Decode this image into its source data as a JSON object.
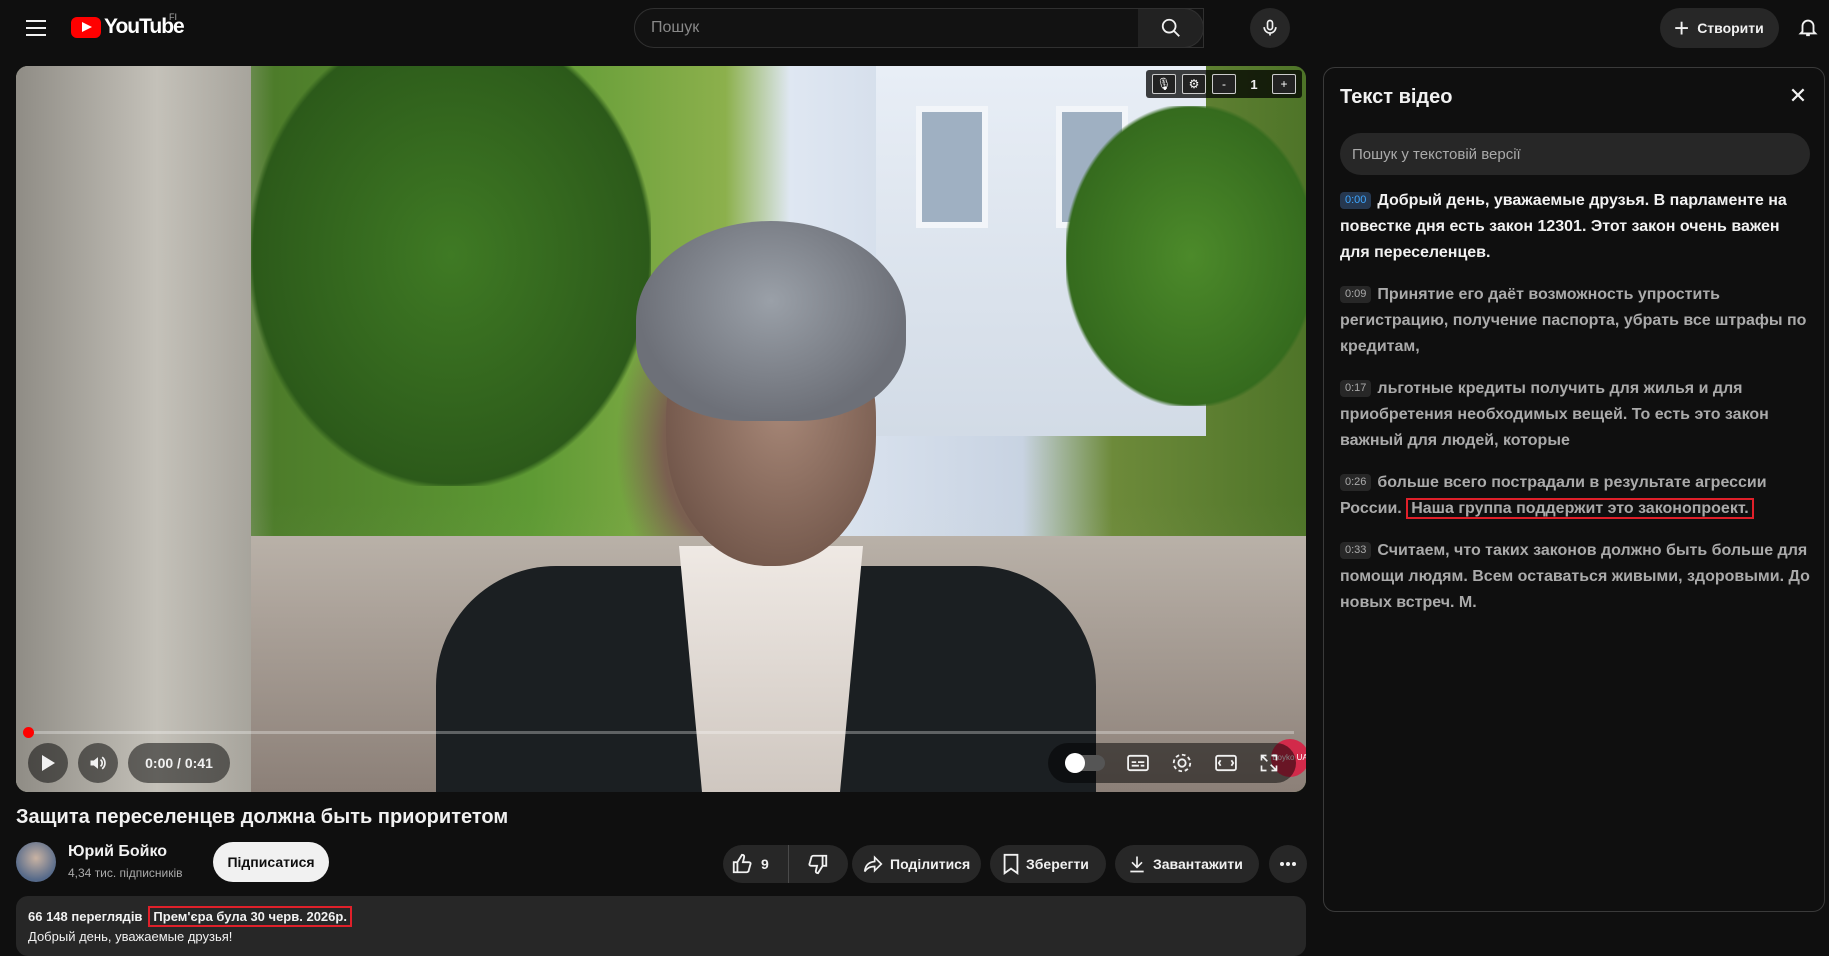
{
  "topbar": {
    "logo_text": "YouTube",
    "country_code": "FI",
    "search_placeholder": "Пошук",
    "create_label": "Створити"
  },
  "player": {
    "time": "0:00 / 0:41",
    "extension_counter": "1",
    "extension_minus": "-",
    "extension_plus": "+",
    "watermark": "Boyko UA",
    "progress": 0
  },
  "video": {
    "title": "Защита переселенцев должна быть приоритетом",
    "channel_name": "Юрий Бойко",
    "subscribers": "4,34 тис. підписників",
    "subscribe_label": "Підписатися",
    "likes": "9",
    "share_label": "Поділитися",
    "save_label": "Зберегти",
    "download_label": "Завантажити"
  },
  "description": {
    "views": "66 148 переглядів",
    "premiere": "Прем'єра була 30 черв. 2026р.",
    "text": "Добрый день, уважаемые друзья!"
  },
  "transcript": {
    "title": "Текст відео",
    "search_placeholder": "Пошук у текстовій версії",
    "segments": [
      {
        "time": "0:00",
        "text": "Добрый день, уважаемые друзья. В парламенте на повестке дня есть закон 12301. Этот закон очень важен для переселенцев."
      },
      {
        "time": "0:09",
        "text": "Принятие его даёт возможность упростить регистрацию, получение паспорта, убрать все штрафы по кредитам,"
      },
      {
        "time": "0:17",
        "text": "льготные кредиты получить для жилья и для приобретения необходимых вещей. То есть это закон важный для людей, которые"
      },
      {
        "time": "0:26",
        "text": "больше всего пострадали в результате агрессии России.",
        "highlight": "Наша группа поддержит это законопроект."
      },
      {
        "time": "0:33",
        "text": "Считаем, что таких законов должно быть больше для помощи людям. Всем оставаться живыми, здоровыми. До новых встреч. М."
      }
    ]
  },
  "colors": {
    "accent_red": "#ff0000",
    "highlight_border": "#e0202a",
    "timestamp_active": "#3ea6ff"
  }
}
